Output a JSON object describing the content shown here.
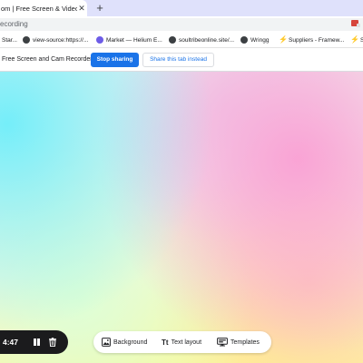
{
  "browser": {
    "tab_title": "om | Free Screen & Video Recor",
    "tab_close": "✕",
    "new_tab": "+",
    "address": "ecording",
    "bookmarks": [
      {
        "label": "Star...",
        "icon": "none"
      },
      {
        "label": "view-source:https://...",
        "icon": "globe-icon"
      },
      {
        "label": "Market — Helium E...",
        "icon": "helium-icon"
      },
      {
        "label": "soultribeonline.site/...",
        "icon": "globe-icon"
      },
      {
        "label": "Wringg",
        "icon": "globe-icon"
      },
      {
        "label": "Suppliers - Framew...",
        "icon": "bolt-icon"
      },
      {
        "label": "S",
        "icon": "bolt-icon"
      }
    ]
  },
  "infobar": {
    "message": "Free Screen and Cam Recorder",
    "stop_label": "Stop sharing",
    "share_label": "Share this tab instead"
  },
  "recorder": {
    "timer": "4:47"
  },
  "toolbar": {
    "background_label": "Background",
    "text_layout_label": "Text layout",
    "text_layout_glyph": "Tt",
    "templates_label": "Templates"
  },
  "colors": {
    "tabstrip_bg": "#dfe1fb",
    "primary_button": "#1a73e8",
    "recorder_bg": "#1b1b1d"
  }
}
